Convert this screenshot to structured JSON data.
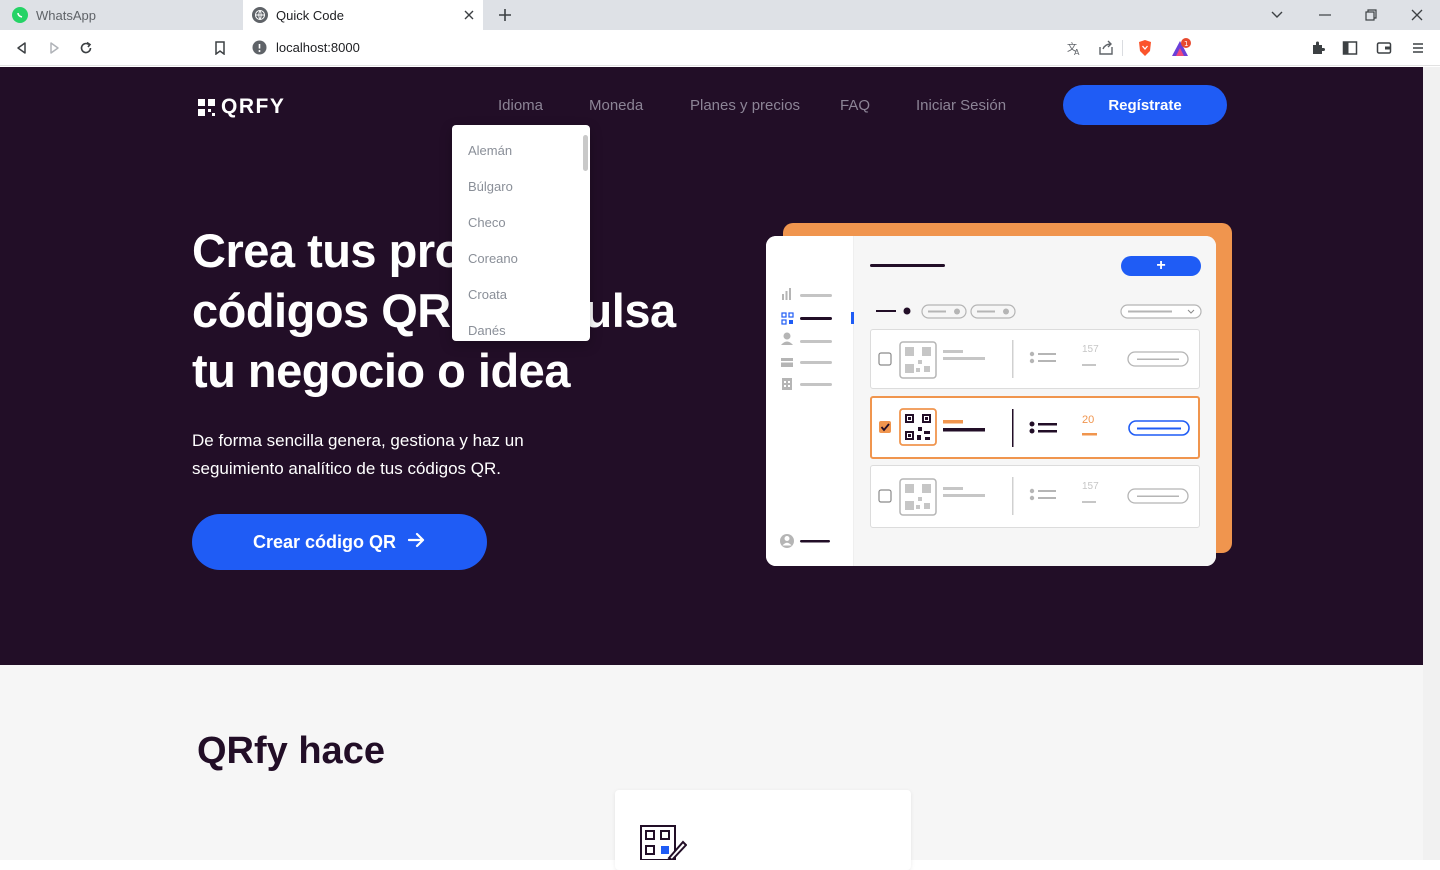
{
  "browser": {
    "tabs": [
      {
        "title": "WhatsApp",
        "active": false
      },
      {
        "title": "Quick Code",
        "active": true
      }
    ],
    "url": "localhost:8000"
  },
  "site": {
    "logo_text": "QRFY",
    "nav": [
      "Idioma",
      "Moneda",
      "Planes y precios",
      "FAQ",
      "Iniciar Sesión"
    ],
    "signup_label": "Regístrate",
    "language_menu": [
      "Alemán",
      "Búlgaro",
      "Checo",
      "Coreano",
      "Croata",
      "Danés"
    ],
    "hero": {
      "title": "Crea tus propios códigos QR e impulsa tu negocio o idea",
      "subtitle": "De forma sencilla genera, gestiona y haz un seguimiento analítico de tus códigos QR.",
      "cta_label": "Crear código QR"
    },
    "illustration": {
      "plus_label": "+",
      "row_counts": [
        "157",
        "20",
        "157"
      ]
    },
    "section2": {
      "title": "QRfy hace"
    }
  },
  "colors": {
    "hero_bg": "#220e27",
    "primary": "#1f5cf5",
    "accent_orange": "#f0954e"
  }
}
